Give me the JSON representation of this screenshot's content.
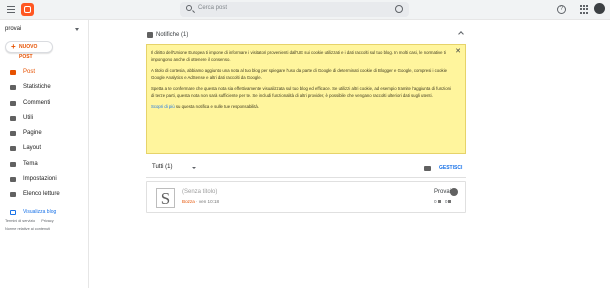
{
  "topbar": {
    "search_placeholder": "Cerca post"
  },
  "sidebar": {
    "blog_name": "provai",
    "new_post": "NUOVO POST",
    "items": [
      {
        "label": "Post",
        "icon": "posts-icon",
        "active": true
      },
      {
        "label": "Statistiche",
        "icon": "stats-icon"
      },
      {
        "label": "Commenti",
        "icon": "comments-icon"
      },
      {
        "label": "Utili",
        "icon": "earnings-icon"
      },
      {
        "label": "Pagine",
        "icon": "pages-icon"
      },
      {
        "label": "Layout",
        "icon": "layout-icon"
      },
      {
        "label": "Tema",
        "icon": "theme-icon"
      },
      {
        "label": "Impostazioni",
        "icon": "settings-icon"
      },
      {
        "label": "Elenco letture",
        "icon": "reading-list-icon"
      }
    ],
    "view_blog": "Visualizza blog",
    "footer": {
      "terms": "Termini di servizio",
      "privacy": "Privacy",
      "content_policy": "Norme relative ai contenuti"
    }
  },
  "notifications": {
    "header": "Notifiche (1)",
    "paragraph1": "Il diritto dell'Unione Europea ti impone di informare i visitatori provenienti dall'UE sui cookie utilizzati e i dati raccolti sul tuo blog. In molti casi, le normative ti impongono anche di ottenere il consenso.",
    "paragraph2": "A titolo di cortesia, abbiamo aggiunto una nota al tuo blog per spiegare l'uso da parte di Google di determinati cookie di Blogger e Google, compresi i cookie Google Analytics e AdSense e altri dati raccolti da Google.",
    "paragraph3": "Spetta a te confermare che questa nota sia effettivamente visualizzata sul tuo blog ed efficace. Se utilizzi altri cookie, ad esempio tramite l'aggiunta di funzioni di terze parti, questa nota non sarà sufficiente per te. Se includi funzionalità di altri provider, è possibile che vengano raccolti ulteriori dati sugli utenti.",
    "link": "Scopri di più",
    "link_rest": "su questa notifica e sulle tue responsabilità."
  },
  "posts": {
    "filter": "Tutti (1)",
    "manage": "GESTISCI",
    "items": [
      {
        "thumb": "S",
        "title": "(Senza titolo)",
        "status": "Bozza",
        "date": "ven 10:18",
        "author": "Provai",
        "comments": "0",
        "views": "0"
      }
    ]
  }
}
